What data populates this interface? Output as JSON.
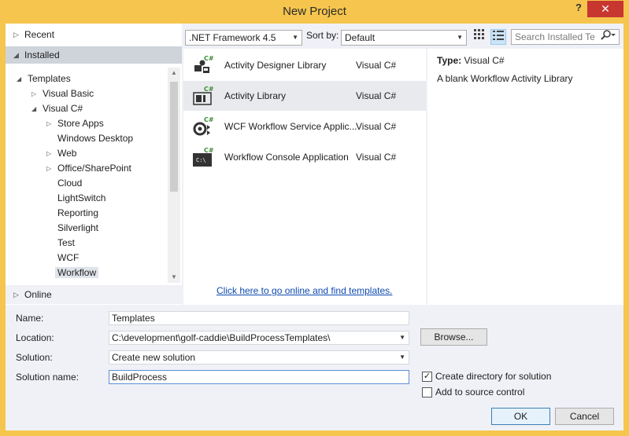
{
  "window": {
    "title": "New Project",
    "help_label": "?",
    "close_label": "✕"
  },
  "left_panel": {
    "recent": "Recent",
    "installed": "Installed",
    "online": "Online",
    "tree": [
      {
        "label": "Templates",
        "expanded": true
      },
      {
        "label": "Visual Basic",
        "expanded": false
      },
      {
        "label": "Visual C#",
        "expanded": true
      },
      {
        "label": "Store Apps",
        "expanded": false
      },
      {
        "label": "Windows Desktop"
      },
      {
        "label": "Web",
        "expanded": false
      },
      {
        "label": "Office/SharePoint",
        "expanded": false
      },
      {
        "label": "Cloud"
      },
      {
        "label": "LightSwitch"
      },
      {
        "label": "Reporting"
      },
      {
        "label": "Silverlight"
      },
      {
        "label": "Test"
      },
      {
        "label": "WCF"
      },
      {
        "label": "Workflow",
        "selected": true
      }
    ]
  },
  "toolbar": {
    "framework": ".NET Framework 4.5",
    "sort_by_label": "Sort by:",
    "sort_value": "Default",
    "search_placeholder": "Search Installed Te"
  },
  "templates": [
    {
      "name": "Activity Designer Library",
      "lang": "Visual C#",
      "icon": "activity-designer-library-icon"
    },
    {
      "name": "Activity Library",
      "lang": "Visual C#",
      "icon": "activity-library-icon",
      "selected": true
    },
    {
      "name": "WCF Workflow Service Applic...",
      "lang": "Visual C#",
      "icon": "wcf-workflow-service-icon"
    },
    {
      "name": "Workflow Console Application",
      "lang": "Visual C#",
      "icon": "workflow-console-app-icon"
    }
  ],
  "online_link": "Click here to go online and find templates.",
  "description": {
    "type_label": "Type:",
    "type_value": "Visual C#",
    "text": "A blank Workflow Activity Library"
  },
  "form": {
    "name_label": "Name:",
    "name_value": "Templates",
    "location_label": "Location:",
    "location_value": "C:\\development\\golf-caddie\\BuildProcessTemplates\\",
    "browse_label": "Browse...",
    "solution_label": "Solution:",
    "solution_value": "Create new solution",
    "solution_name_label": "Solution name:",
    "solution_name_value": "BuildProcess",
    "create_dir_label": "Create directory for solution",
    "create_dir_checked": true,
    "source_control_label": "Add to source control",
    "source_control_checked": false,
    "ok_label": "OK",
    "cancel_label": "Cancel"
  },
  "colors": {
    "title_bar": "#f5c54e",
    "close_button": "#c7372f",
    "link": "#0e4ab0",
    "csharp_badge": "#388a34"
  }
}
